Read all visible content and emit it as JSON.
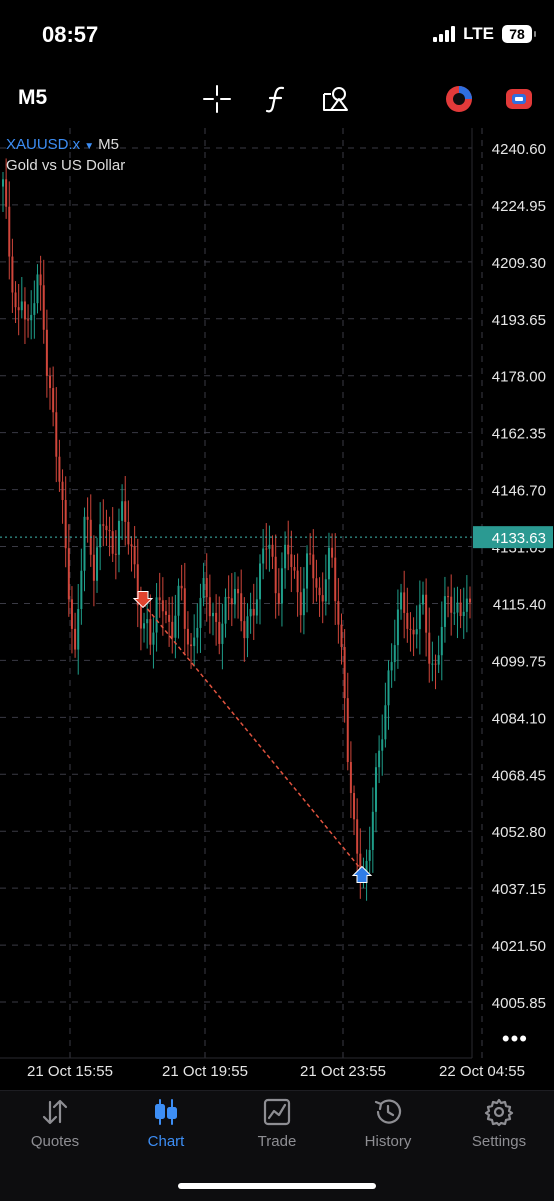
{
  "status_bar": {
    "time": "08:57",
    "network": "LTE",
    "battery": "78"
  },
  "toolbar": {
    "timeframe": "M5",
    "tools": [
      {
        "name": "crosshair-icon"
      },
      {
        "name": "indicators-icon"
      },
      {
        "name": "objects-icon"
      },
      {
        "name": "app-logo-icon"
      },
      {
        "name": "account-toggle-icon"
      }
    ]
  },
  "symbol": {
    "name": "XAUUSD.x",
    "timeframe": "M5",
    "description": "Gold vs US Dollar"
  },
  "colors": {
    "bull": "#1f9e8a",
    "bear": "#d0463b",
    "accent": "#3d8ef5",
    "price_line": "#3fb8b0",
    "grid": "#3a3a44"
  },
  "chart_data": {
    "type": "candlestick",
    "price_axis": [
      "4240.60",
      "4224.95",
      "4209.30",
      "4193.65",
      "4178.00",
      "4162.35",
      "4146.70",
      "4131.05",
      "4115.40",
      "4099.75",
      "4084.10",
      "4068.45",
      "4052.80",
      "4037.15",
      "4021.50",
      "4005.85"
    ],
    "time_axis": [
      "21 Oct 15:55",
      "21 Oct 19:55",
      "21 Oct 23:55",
      "22 Oct 04:55"
    ],
    "ylim": [
      3992,
      4247
    ],
    "current_price": "4133.63",
    "trade": {
      "entry": {
        "side": "sell",
        "price": 4115.4
      },
      "exit": {
        "side": "buy",
        "price": 4042.0
      }
    },
    "close_path": [
      4230,
      4215,
      4205,
      4192,
      4200,
      4188,
      4195,
      4210,
      4198,
      4180,
      4170,
      4160,
      4150,
      4128,
      4112,
      4100,
      4125,
      4140,
      4130,
      4122,
      4136,
      4142,
      4132,
      4125,
      4138,
      4144,
      4135,
      4125,
      4116,
      4108,
      4112,
      4104,
      4113,
      4118,
      4112,
      4107,
      4114,
      4118,
      4110,
      4102,
      4108,
      4114,
      4121,
      4116,
      4110,
      4105,
      4112,
      4118,
      4122,
      4114,
      4106,
      4110,
      4116,
      4121,
      4128,
      4133,
      4126,
      4118,
      4124,
      4130,
      4126,
      4120,
      4116,
      4124,
      4128,
      4120,
      4116,
      4124,
      4128,
      4118,
      4108,
      4090,
      4065,
      4050,
      4045,
      4040,
      4048,
      4060,
      4072,
      4085,
      4095,
      4102,
      4110,
      4118,
      4112,
      4104,
      4110,
      4116,
      4108,
      4100,
      4095,
      4108,
      4116,
      4118,
      4114,
      4110,
      4116,
      4114
    ]
  },
  "chart_ui": {
    "more_label": "•••"
  },
  "tabs": [
    {
      "label": "Quotes",
      "icon": "quotes-icon",
      "active": false
    },
    {
      "label": "Chart",
      "icon": "chart-icon",
      "active": true
    },
    {
      "label": "Trade",
      "icon": "trade-icon",
      "active": false
    },
    {
      "label": "History",
      "icon": "history-icon",
      "active": false
    },
    {
      "label": "Settings",
      "icon": "settings-icon",
      "active": false
    }
  ]
}
